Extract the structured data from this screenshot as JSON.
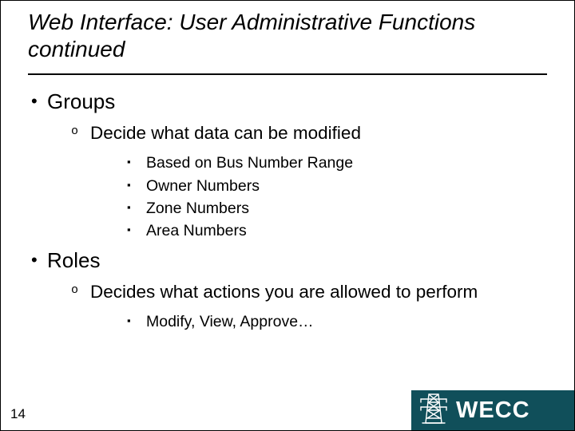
{
  "title": "Web Interface: User Administrative Functions continued",
  "bullets": {
    "groups": {
      "label": "Groups",
      "sub1": {
        "label": "Decide what data can be modified",
        "items": [
          "Based on Bus Number Range",
          "Owner Numbers",
          "Zone Numbers",
          "Area Numbers"
        ]
      }
    },
    "roles": {
      "label": "Roles",
      "sub1": {
        "label": "Decides what actions you are allowed to perform",
        "items": [
          "Modify, View, Approve…"
        ]
      }
    }
  },
  "page_number": "14",
  "logo_text": "WECC"
}
